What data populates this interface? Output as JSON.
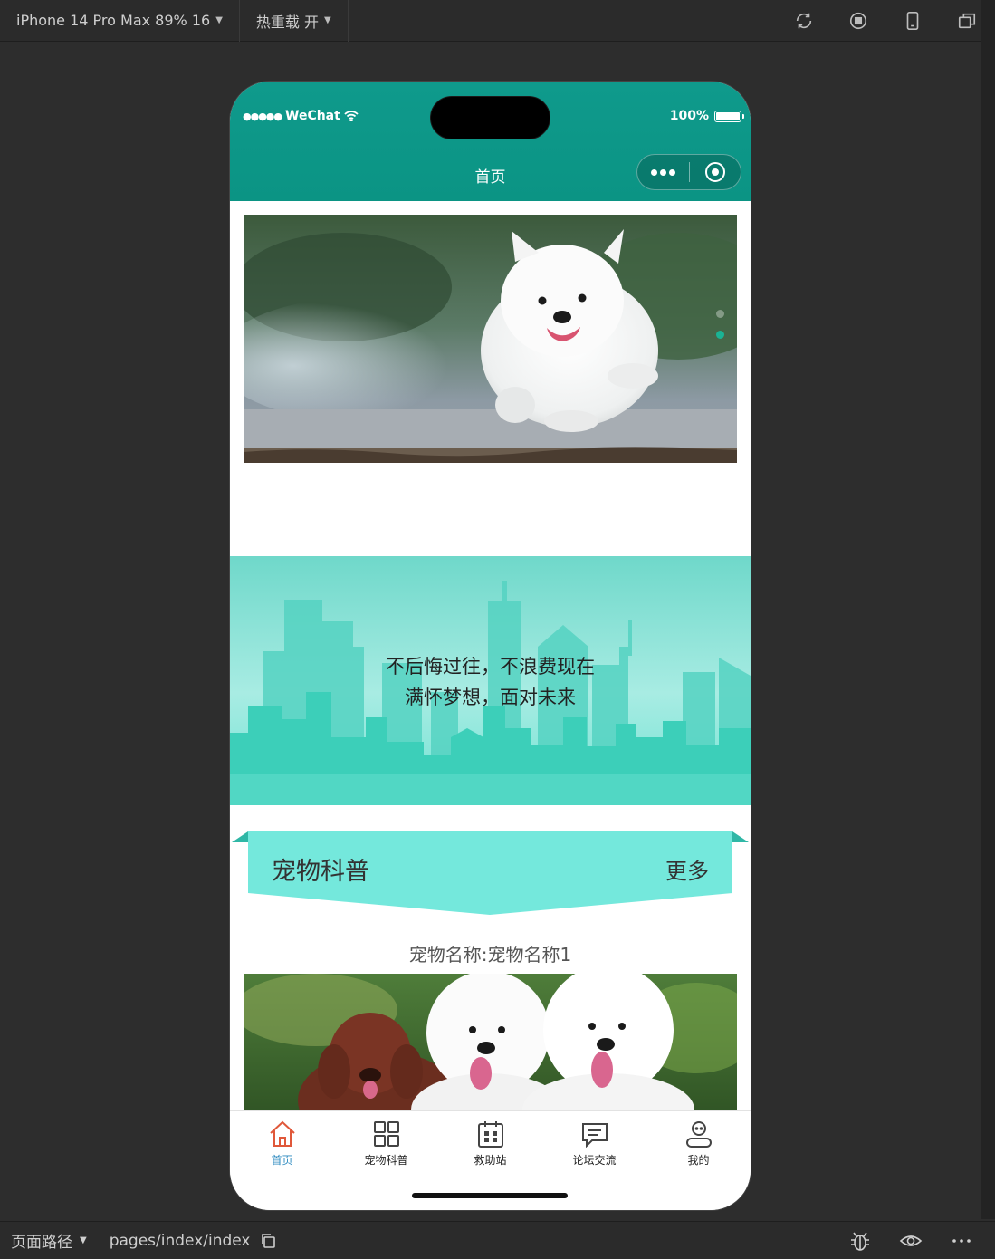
{
  "toolbar": {
    "device": "iPhone 14 Pro Max 89% 16",
    "hot_reload": "热重载 开"
  },
  "status_bar": {
    "carrier": "WeChat",
    "battery": "100%"
  },
  "nav": {
    "title": "首页"
  },
  "motto": {
    "line1": "不后悔过往，不浪费现在",
    "line2": "满怀梦想，面对未来"
  },
  "section": {
    "title": "宠物科普",
    "more": "更多"
  },
  "pet": {
    "name": "宠物名称:宠物名称1"
  },
  "tabbar": {
    "items": [
      {
        "label": "首页",
        "icon": "home-icon",
        "active": true
      },
      {
        "label": "宠物科普",
        "icon": "grid-icon",
        "active": false
      },
      {
        "label": "救助站",
        "icon": "calendar-icon",
        "active": false
      },
      {
        "label": "论坛交流",
        "icon": "chat-icon",
        "active": false
      },
      {
        "label": "我的",
        "icon": "user-icon",
        "active": false
      }
    ]
  },
  "bottom_bar": {
    "label": "页面路径",
    "path": "pages/index/index"
  },
  "colors": {
    "nav_bg": "#0f9a8c",
    "accent": "#1ab394",
    "section_band": "#74e8dc",
    "tab_active": "#2e8bc0",
    "home_icon_active": "#e0583a"
  }
}
